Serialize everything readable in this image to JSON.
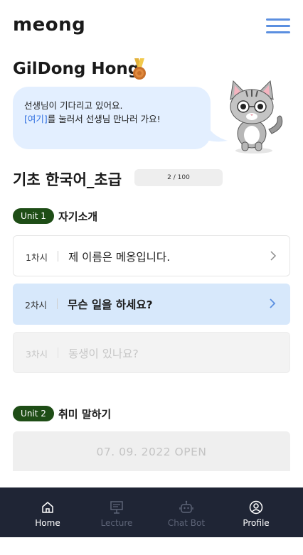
{
  "header": {
    "logo": "meong"
  },
  "user": {
    "name": "GilDong Hong"
  },
  "bubble": {
    "line1": "선생님이 기다리고 있어요.",
    "link": "[여기]",
    "line2_rest": "를 눌러서 선생님 만나러 가요!"
  },
  "course": {
    "title": "기초 한국어_초급",
    "progress": "2 / 100",
    "progress_value": 2,
    "progress_total": 100
  },
  "units": [
    {
      "badge": "Unit 1",
      "title": "자기소개",
      "lessons": [
        {
          "num": "1차시",
          "title": "제 이름은 메옹입니다.",
          "state": "normal"
        },
        {
          "num": "2차시",
          "title": "무슨 일을 하세요?",
          "state": "active"
        },
        {
          "num": "3차시",
          "title": "동생이 있나요?",
          "state": "locked"
        }
      ]
    },
    {
      "badge": "Unit 2",
      "title": "취미 말하기",
      "open_text": "07. 09. 2022 OPEN"
    }
  ],
  "nav": [
    {
      "label": "Home",
      "icon": "home-icon",
      "active": true
    },
    {
      "label": "Lecture",
      "icon": "lecture-icon",
      "active": false
    },
    {
      "label": "Chat Bot",
      "icon": "chatbot-icon",
      "active": false
    },
    {
      "label": "Profile",
      "icon": "profile-icon",
      "active": true
    }
  ],
  "colors": {
    "accent_blue": "#5b8fe0",
    "link_blue": "#2f6fe0",
    "bubble_bg": "#e3efff",
    "unit_badge": "#1e4d16",
    "active_lesson": "#d7e8fb",
    "nav_bg": "#1f2535"
  }
}
